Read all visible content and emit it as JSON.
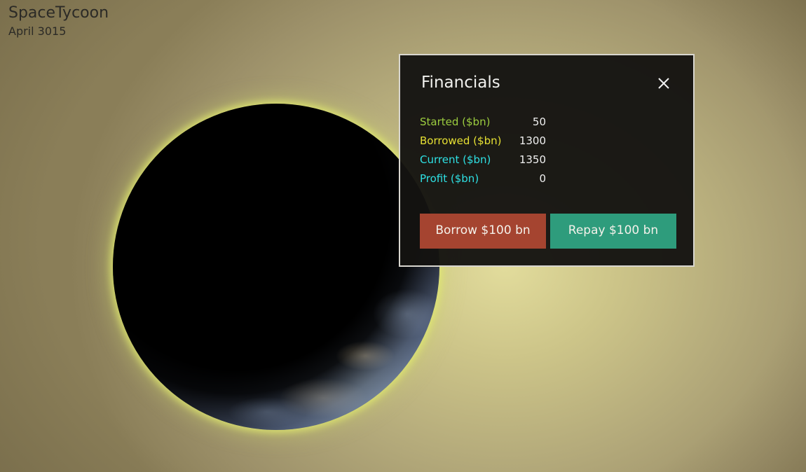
{
  "hud": {
    "title": "SpaceTycoon",
    "date": "April 3015"
  },
  "financials": {
    "title": "Financials",
    "close_icon": "close-icon",
    "rows": [
      {
        "label": "Started ($bn)",
        "value": "50",
        "color": "#9ccd3f"
      },
      {
        "label": "Borrowed ($bn)",
        "value": "1300",
        "color": "#e6e033"
      },
      {
        "label": "Current ($bn)",
        "value": "1350",
        "color": "#2ee0e3"
      },
      {
        "label": "Profit ($bn)",
        "value": "0",
        "color": "#2ee0e3"
      }
    ],
    "borrow_label": "Borrow $100 bn",
    "repay_label": "Repay $100 bn",
    "borrow_color": "#a54430",
    "repay_color": "#2e9c7c"
  }
}
